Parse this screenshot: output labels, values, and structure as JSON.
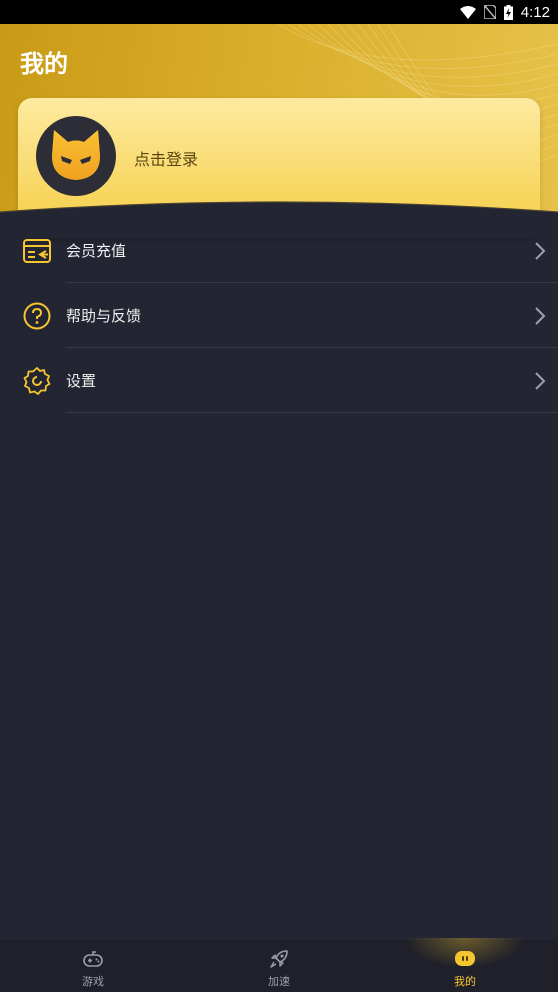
{
  "status_bar": {
    "time": "4:12",
    "icons": [
      "wifi-icon",
      "no-sim-icon",
      "battery-charging-icon"
    ]
  },
  "header": {
    "title": "我的"
  },
  "profile": {
    "login_text": "点击登录",
    "avatar_icon": "cat-avatar-icon"
  },
  "menu": {
    "items": [
      {
        "label": "会员充值",
        "icon": "membership-card-icon"
      },
      {
        "label": "帮助与反馈",
        "icon": "help-question-icon"
      },
      {
        "label": "设置",
        "icon": "settings-gear-icon"
      }
    ]
  },
  "bottom_nav": {
    "items": [
      {
        "label": "游戏",
        "icon": "gamepad-icon",
        "active": false
      },
      {
        "label": "加速",
        "icon": "rocket-icon",
        "active": false
      },
      {
        "label": "我的",
        "icon": "profile-face-icon",
        "active": true
      }
    ]
  },
  "colors": {
    "accent": "#f5c62e",
    "background": "#232532",
    "header_gold": "#d9ae2a"
  }
}
